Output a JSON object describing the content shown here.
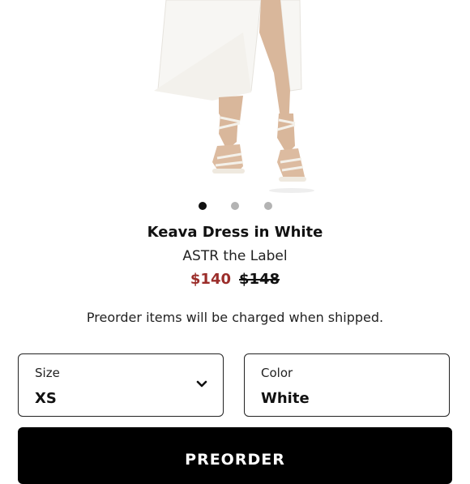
{
  "product": {
    "title": "Keava Dress in White",
    "brand": "ASTR the Label",
    "price_sale": "$140",
    "price_original": "$148",
    "notice": "Preorder items will be charged when shipped."
  },
  "carousel": {
    "count": 3,
    "active_index": 0
  },
  "size_select": {
    "label": "Size",
    "value": "XS"
  },
  "color_select": {
    "label": "Color",
    "value": "White"
  },
  "cta": {
    "label": "PREORDER"
  },
  "colors": {
    "sale_price": "#9b2d2a",
    "button_bg": "#000000",
    "dot_active": "#111111",
    "dot_inactive": "#b3b3b3"
  }
}
